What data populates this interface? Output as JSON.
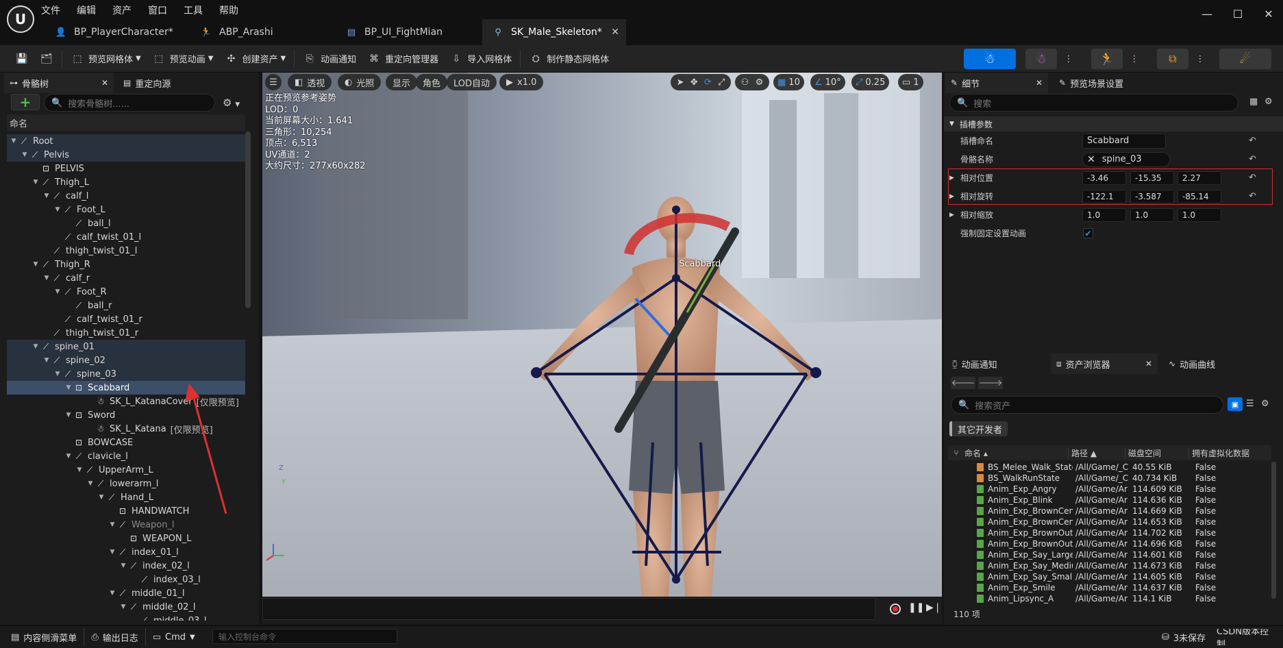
{
  "menu": [
    "文件",
    "编辑",
    "资产",
    "窗口",
    "工具",
    "帮助"
  ],
  "tabs": [
    {
      "label": "BP_PlayerCharacter*",
      "icon": "blueprint-character-icon"
    },
    {
      "label": "ABP_Arashi",
      "icon": "anim-blueprint-icon"
    },
    {
      "label": "BP_UI_FightMian",
      "icon": "widget-blueprint-icon"
    },
    {
      "label": "SK_Male_Skeleton*",
      "icon": "skeleton-icon",
      "active": true
    }
  ],
  "toolbar": {
    "preview_mesh": "预览网格体",
    "preview_anim": "预览动画",
    "create_asset": "创建资产",
    "anim_notify": "动画通知",
    "retarget_manager": "重定向管理器",
    "import_mesh": "导入网格体",
    "make_static_mesh": "制作静态网格体"
  },
  "skeleton_panel": {
    "tab_tree": "骨骼树",
    "tab_retarget": "重定向源",
    "search_placeholder": "搜索骨骼树......",
    "column_header": "命名"
  },
  "tree": [
    {
      "label": "Root",
      "depth": 0,
      "type": "bone",
      "hl": true,
      "arrow": "down"
    },
    {
      "label": "Pelvis",
      "depth": 1,
      "type": "bone",
      "hl": true,
      "arrow": "down"
    },
    {
      "label": "PELVIS",
      "depth": 2,
      "type": "socket"
    },
    {
      "label": "Thigh_L",
      "depth": 2,
      "type": "bone",
      "arrow": "down"
    },
    {
      "label": "calf_l",
      "depth": 3,
      "type": "bone",
      "arrow": "down"
    },
    {
      "label": "Foot_L",
      "depth": 4,
      "type": "bone",
      "arrow": "down"
    },
    {
      "label": "ball_l",
      "depth": 5,
      "type": "bone"
    },
    {
      "label": "calf_twist_01_l",
      "depth": 4,
      "type": "bone"
    },
    {
      "label": "thigh_twist_01_l",
      "depth": 3,
      "type": "bone"
    },
    {
      "label": "Thigh_R",
      "depth": 2,
      "type": "bone",
      "arrow": "down"
    },
    {
      "label": "calf_r",
      "depth": 3,
      "type": "bone",
      "arrow": "down"
    },
    {
      "label": "Foot_R",
      "depth": 4,
      "type": "bone",
      "arrow": "down"
    },
    {
      "label": "ball_r",
      "depth": 5,
      "type": "bone"
    },
    {
      "label": "calf_twist_01_r",
      "depth": 4,
      "type": "bone"
    },
    {
      "label": "thigh_twist_01_r",
      "depth": 3,
      "type": "bone"
    },
    {
      "label": "spine_01",
      "depth": 2,
      "type": "bone",
      "hl": true,
      "arrow": "down"
    },
    {
      "label": "spine_02",
      "depth": 3,
      "type": "bone",
      "hl": true,
      "arrow": "down"
    },
    {
      "label": "spine_03",
      "depth": 4,
      "type": "bone",
      "hl": true,
      "arrow": "down"
    },
    {
      "label": "Scabbard",
      "depth": 5,
      "type": "socket",
      "sel": true,
      "arrow": "down"
    },
    {
      "label": "SK_L_KatanaCover",
      "suffix": "[仅限预览]",
      "depth": 7,
      "type": "mesh"
    },
    {
      "label": "Sword",
      "depth": 5,
      "type": "socket",
      "arrow": "down"
    },
    {
      "label": "SK_L_Katana",
      "suffix": "[仅限预览]",
      "depth": 7,
      "type": "mesh"
    },
    {
      "label": "BOWCASE",
      "depth": 5,
      "type": "socket"
    },
    {
      "label": "clavicle_l",
      "depth": 5,
      "type": "bone",
      "arrow": "down"
    },
    {
      "label": "UpperArm_L",
      "depth": 6,
      "type": "bone",
      "arrow": "down"
    },
    {
      "label": "lowerarm_l",
      "depth": 7,
      "type": "bone",
      "arrow": "down"
    },
    {
      "label": "Hand_L",
      "depth": 8,
      "type": "bone",
      "arrow": "down"
    },
    {
      "label": "HANDWATCH",
      "depth": 9,
      "type": "socket"
    },
    {
      "label": "Weapon_l",
      "depth": 9,
      "type": "bone",
      "dim": true,
      "arrow": "down"
    },
    {
      "label": "WEAPON_L",
      "depth": 10,
      "type": "socket"
    },
    {
      "label": "index_01_l",
      "depth": 9,
      "type": "bone",
      "arrow": "down"
    },
    {
      "label": "index_02_l",
      "depth": 10,
      "type": "bone",
      "arrow": "down"
    },
    {
      "label": "index_03_l",
      "depth": 11,
      "type": "bone"
    },
    {
      "label": "middle_01_l",
      "depth": 9,
      "type": "bone",
      "arrow": "down"
    },
    {
      "label": "middle_02_l",
      "depth": 10,
      "type": "bone",
      "arrow": "down"
    },
    {
      "label": "middle_03_l",
      "depth": 11,
      "type": "bone"
    }
  ],
  "viewport": {
    "menu_icon": "hamburger-icon",
    "perspective": "透视",
    "lighting": "光照",
    "show": "显示",
    "character": "角色",
    "lod": "LOD自动",
    "play_speed": "x1.0",
    "grid_value": "10",
    "angle_value": "10°",
    "scale_value": "0.25",
    "camera_value": "1",
    "info": [
      "正在预览参考姿势",
      "LOD：0",
      "当前屏幕大小：1.641",
      "三角形：10,254",
      "顶点：6,513",
      "UV通道：2",
      "大约尺寸：277x60x282"
    ],
    "socket_label": "Scabbard",
    "axis_z": "Z",
    "axis_y": "Y"
  },
  "details": {
    "tab_details": "细节",
    "tab_preview": "预览场景设置",
    "search_placeholder": "搜索",
    "section": "插槽参数",
    "socket_name_label": "插槽命名",
    "socket_name_value": "Scabbard",
    "bone_name_label": "骨骼名称",
    "bone_name_value": "spine_03",
    "rows": [
      {
        "label": "相对位置",
        "values": [
          "-3.46",
          "-15.35",
          "2.27"
        ]
      },
      {
        "label": "相对旋转",
        "values": [
          "-122.1",
          "-3.587",
          "-85.14"
        ]
      },
      {
        "label": "相对缩放",
        "values": [
          "1.0",
          "1.0",
          "1.0"
        ]
      }
    ],
    "force_label": "强制固定设置动画"
  },
  "asset_browser": {
    "tab_notify": "动画通知",
    "tab_browser": "资产浏览器",
    "tab_curves": "动画曲线",
    "search_placeholder": "搜索资产",
    "filter_chip": "其它开发者",
    "columns": [
      "命名",
      "路径",
      "磁盘空间",
      "拥有虚拟化数据"
    ],
    "rows": [
      {
        "name": "BS_Melee_Walk_State",
        "path": "/All/Game/_C",
        "size": "40.55 KiB",
        "virt": "False",
        "color": "#d98a3a"
      },
      {
        "name": "BS_WalkRunState",
        "path": "/All/Game/_C",
        "size": "40.734 KiB",
        "virt": "False",
        "color": "#d98a3a"
      },
      {
        "name": "Anim_Exp_Angry",
        "path": "/All/Game/Ar",
        "size": "114.609 KiB",
        "virt": "False",
        "color": "#5aa548"
      },
      {
        "name": "Anim_Exp_Blink",
        "path": "/All/Game/Ar",
        "size": "114.636 KiB",
        "virt": "False",
        "color": "#5aa548"
      },
      {
        "name": "Anim_Exp_BrownCente",
        "path": "/All/Game/Ar",
        "size": "114.669 KiB",
        "virt": "False",
        "color": "#5aa548"
      },
      {
        "name": "Anim_Exp_BrownCente",
        "path": "/All/Game/Ar",
        "size": "114.653 KiB",
        "virt": "False",
        "color": "#5aa548"
      },
      {
        "name": "Anim_Exp_BrownOutte",
        "path": "/All/Game/Ar",
        "size": "114.702 KiB",
        "virt": "False",
        "color": "#5aa548"
      },
      {
        "name": "Anim_Exp_BrownOutte",
        "path": "/All/Game/Ar",
        "size": "114.696 KiB",
        "virt": "False",
        "color": "#5aa548"
      },
      {
        "name": "Anim_Exp_Say_Large",
        "path": "/All/Game/Ar",
        "size": "114.601 KiB",
        "virt": "False",
        "color": "#5aa548"
      },
      {
        "name": "Anim_Exp_Say_Mediur",
        "path": "/All/Game/Ar",
        "size": "114.673 KiB",
        "virt": "False",
        "color": "#5aa548"
      },
      {
        "name": "Anim_Exp_Say_Small",
        "path": "/All/Game/Ar",
        "size": "114.605 KiB",
        "virt": "False",
        "color": "#5aa548"
      },
      {
        "name": "Anim_Exp_Smile",
        "path": "/All/Game/Ar",
        "size": "114.637 KiB",
        "virt": "False",
        "color": "#5aa548"
      },
      {
        "name": "Anim_Lipsync_A",
        "path": "/All/Game/Ar",
        "size": "114.1 KiB",
        "virt": "False",
        "color": "#5aa548"
      }
    ],
    "count": "110 项"
  },
  "statusbar": {
    "content_drawer": "内容侧滑菜单",
    "output_log": "输出日志",
    "cmd": "Cmd",
    "console_placeholder": "输入控制台命令",
    "unsaved": "3未保存",
    "source_control": "CSDN版本控制"
  },
  "colors": {
    "accent": "#0070e0",
    "selection": "#3c4e68",
    "highlight_box": "#d03030"
  }
}
